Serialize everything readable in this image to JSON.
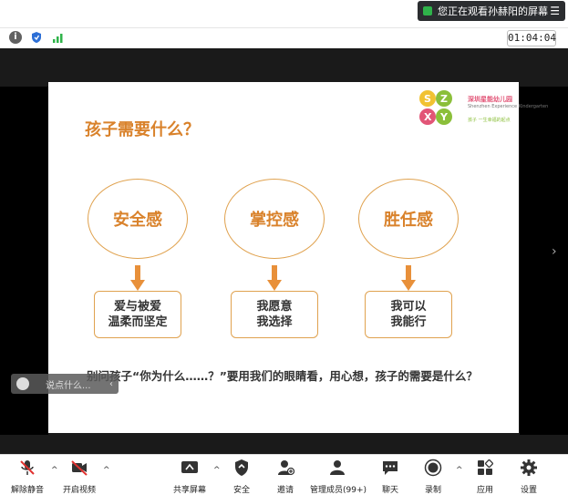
{
  "banner": {
    "text": "您正在观看孙赫阳的屏幕",
    "menu_icon": "menu-icon"
  },
  "statusbar": {
    "timer": "01:04:04"
  },
  "slide": {
    "title": "孩子需要什么？",
    "logo": {
      "line1": "深圳星能幼儿园",
      "line2": "Shenzhen Experience Kindergarten",
      "line3": "孩子 一生幸福的起点"
    },
    "needs": [
      {
        "label": "安全感",
        "detail_line1": "爱与被爱",
        "detail_line2": "温柔而坚定"
      },
      {
        "label": "掌控感",
        "detail_line1": "我愿意",
        "detail_line2": "我选择"
      },
      {
        "label": "胜任感",
        "detail_line1": "我可以",
        "detail_line2": "我能行"
      }
    ],
    "caption": "别问孩子“你为什么……？”要用我们的眼睛看，用心想，孩子的需要是什么？",
    "accent": "#d9822b"
  },
  "chat": {
    "placeholder": "说点什么..."
  },
  "bottombar": {
    "unmute": "解除静音",
    "start_video": "开启视频",
    "share_screen": "共享屏幕",
    "security": "安全",
    "invite": "邀请",
    "participants": "管理成员(99+)",
    "chat": "聊天",
    "record": "录制",
    "apps": "应用",
    "settings": "设置"
  }
}
